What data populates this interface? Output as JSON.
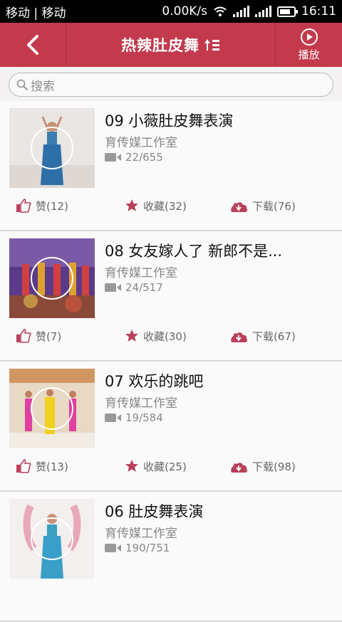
{
  "status_bar": {
    "carrier": "移动 | 移动",
    "network_speed": "0.00K/s",
    "time": "16:11"
  },
  "nav": {
    "title": "热辣肚皮舞",
    "play_label": "播放"
  },
  "search": {
    "placeholder": "搜索"
  },
  "videos": [
    {
      "title": "09 小薇肚皮舞表演",
      "author": "育传媒工作室",
      "count": "22/655",
      "like": "赞(12)",
      "fav": "收藏(32)",
      "download": "下载(76)"
    },
    {
      "title": "08 女友嫁人了 新郎不是...",
      "author": "育传媒工作室",
      "count": "24/517",
      "like": "赞(7)",
      "fav": "收藏(30)",
      "download": "下载(67)"
    },
    {
      "title": "07 欢乐的跳吧",
      "author": "育传媒工作室",
      "count": "19/584",
      "like": "赞(13)",
      "fav": "收藏(25)",
      "download": "下载(98)"
    },
    {
      "title": "06 肚皮舞表演",
      "author": "育传媒工作室",
      "count": "190/751"
    }
  ],
  "colors": {
    "accent": "#c33a4c",
    "icon": "#b8405a"
  }
}
